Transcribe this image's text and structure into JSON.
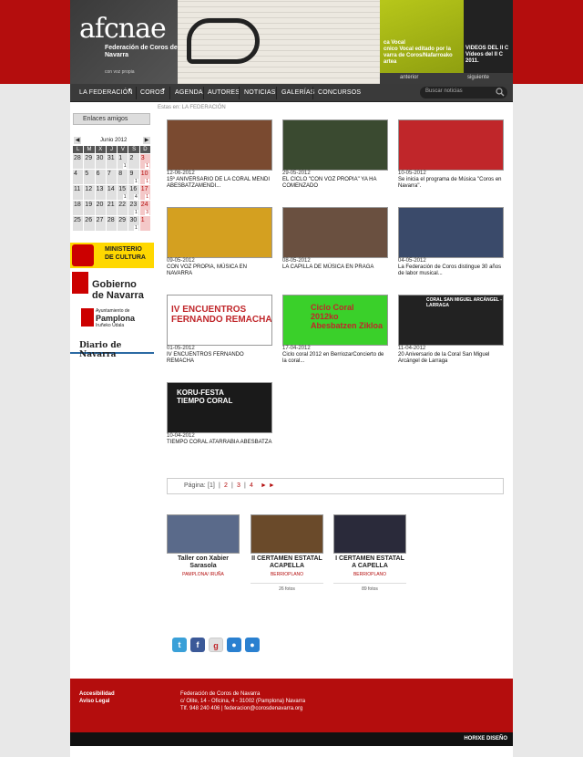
{
  "header": {
    "logo_mark": "afcnae",
    "logo_title": "Federación de Coros de Navarra",
    "logo_sub": "con voz propia",
    "slide1_text": "ca Vocal\ncnico Vocal editado por la\nvarra de Coros/Nafarroako\nartea",
    "slide2_text": "VIDEOS DEL II C\nVídeos del II C\n2011.",
    "prev_label": "anterior",
    "next_label": "siguiente"
  },
  "nav": {
    "items": [
      "LA FEDERACIÓN",
      "COROS",
      "AGENDA",
      "AUTORES",
      "NOTICIAS",
      "GALERÍAS",
      "CONCURSOS"
    ],
    "search_placeholder": "Buscar noticias"
  },
  "breadcrumb": "Estas en: LA FEDERACIÓN",
  "sidebar": {
    "links_button": "Enlaces amigos",
    "calendar": {
      "title": "Junio 2012",
      "prev": "◀",
      "next": "▶",
      "day_headers": [
        "L",
        "M",
        "X",
        "J",
        "V",
        "S",
        "D"
      ],
      "weeks": [
        [
          [
            "28",
            ""
          ],
          [
            "29",
            ""
          ],
          [
            "30",
            ""
          ],
          [
            "31",
            ""
          ],
          [
            "1",
            "1"
          ],
          [
            "2",
            ""
          ],
          [
            "3",
            "1"
          ]
        ],
        [
          [
            "4",
            ""
          ],
          [
            "5",
            ""
          ],
          [
            "6",
            ""
          ],
          [
            "7",
            ""
          ],
          [
            "8",
            ""
          ],
          [
            "9",
            "1"
          ],
          [
            "10",
            "1"
          ]
        ],
        [
          [
            "11",
            ""
          ],
          [
            "12",
            ""
          ],
          [
            "13",
            ""
          ],
          [
            "14",
            ""
          ],
          [
            "15",
            "1"
          ],
          [
            "16",
            "4"
          ],
          [
            "17",
            "1"
          ]
        ],
        [
          [
            "18",
            ""
          ],
          [
            "19",
            ""
          ],
          [
            "20",
            ""
          ],
          [
            "21",
            ""
          ],
          [
            "22",
            ""
          ],
          [
            "23",
            "1"
          ],
          [
            "24",
            "3"
          ]
        ],
        [
          [
            "25",
            ""
          ],
          [
            "26",
            ""
          ],
          [
            "27",
            ""
          ],
          [
            "28",
            ""
          ],
          [
            "29",
            ""
          ],
          [
            "30",
            "1"
          ],
          [
            "1",
            ""
          ]
        ]
      ]
    },
    "sponsors": {
      "ministry": "MINISTERIO\nDE CULTURA",
      "gobierno": "Gobierno\nde Navarra",
      "pamplona_small": "Ayuntamiento de",
      "pamplona_big": "Pamplona",
      "pamplona_sub": "Iruñeko Udala",
      "diario": "Diario de Navarra"
    }
  },
  "news": [
    {
      "date": "12-06-2012",
      "title": "15º ANIVERSARIO DE LA CORAL MENDI ABESBATZAMENDI...",
      "color": "#7a4a30"
    },
    {
      "date": "29-05-2012",
      "title": "EL CICLO \"CON VOZ PROPIA\" YA HA COMENZADO",
      "color": "#3a4a30"
    },
    {
      "date": "10-05-2012",
      "title": "Se inicia el programa de Música \"Coros en Navarra\".",
      "color": "#c0262a"
    },
    {
      "date": "09-05-2012",
      "title": "CON VOZ PROPIA, MÚSICA EN NAVARRA",
      "color": "#d4a020"
    },
    {
      "date": "08-05-2012",
      "title": "LA CAPILLA DE MÚSICA EN PRAGA",
      "color": "#6a5040"
    },
    {
      "date": "04-05-2012",
      "title": "La Federación de Coros distingue 30 años de labor musical...",
      "color": "#3a4a6a"
    },
    {
      "date": "01-05-2012",
      "title": "IV ENCUENTROS FERNANDO REMACHA",
      "color": "#ffffff"
    },
    {
      "date": "17-04-2012",
      "title": "Ciclo coral 2012 en BerriozarConcierto de la coral...",
      "color": "#3ad02a"
    },
    {
      "date": "11-04-2012",
      "title": "20 Aniversario de la Coral San Miguel Arcángel de Larraga",
      "color": "#222222"
    },
    {
      "date": "10-04-2012",
      "title": "TIEMPO CORAL ATARRABIA ABESBATZA",
      "color": "#1a1a1a"
    }
  ],
  "thumb_text": {
    "remacha": "IV ENCUENTROS\nFERNANDO REMACHA",
    "ciclo": "Ciclo Coral\n2012ko\nAbesbatzen Zikloa",
    "larraga": "CORAL SAN MIGUEL ARCÁNGEL - LARRAGA",
    "koru": "KORU-FESTA\nTIEMPO CORAL"
  },
  "pager": {
    "label": "Página:",
    "pages": [
      "[1]",
      "2",
      "3",
      "4"
    ],
    "arrows": "► ►"
  },
  "galleries": [
    {
      "title": "Taller con Xabier Sarasola",
      "location": "PAMPLONA/ IRUÑA",
      "count": "",
      "color": "#5a6a8a"
    },
    {
      "title": "II CERTAMEN ESTATAL ACAPELLA",
      "location": "BERRIOPLANO",
      "count": "26 fotos",
      "color": "#6a4a2a"
    },
    {
      "title": "I CERTAMEN ESTATAL A CAPELLA",
      "location": "BERRIOPLANO",
      "count": "89 fotos",
      "color": "#2a2a3a"
    }
  ],
  "social": [
    {
      "icon": "twitter-icon",
      "glyph": "t",
      "color": "#3aa0d8"
    },
    {
      "icon": "facebook-icon",
      "glyph": "f",
      "color": "#3b5998"
    },
    {
      "icon": "google-icon",
      "glyph": "g",
      "color": "#e0e0e0"
    },
    {
      "icon": "messenger-icon",
      "glyph": "●",
      "color": "#2a80d0"
    },
    {
      "icon": "tuenti-icon",
      "glyph": "●",
      "color": "#2a80d0"
    }
  ],
  "footer": {
    "links": [
      "Accesibilidad",
      "Aviso Legal"
    ],
    "org": "Federación de Coros de Navarra",
    "address": "c/ Olite, 14 - Oficina, 4 - 31002 (Pamplona) Navarra",
    "contact": "Tlf. 948 240 406  | federacion@corosdenavarra.org",
    "credit": "HORIXE DISEÑO"
  }
}
